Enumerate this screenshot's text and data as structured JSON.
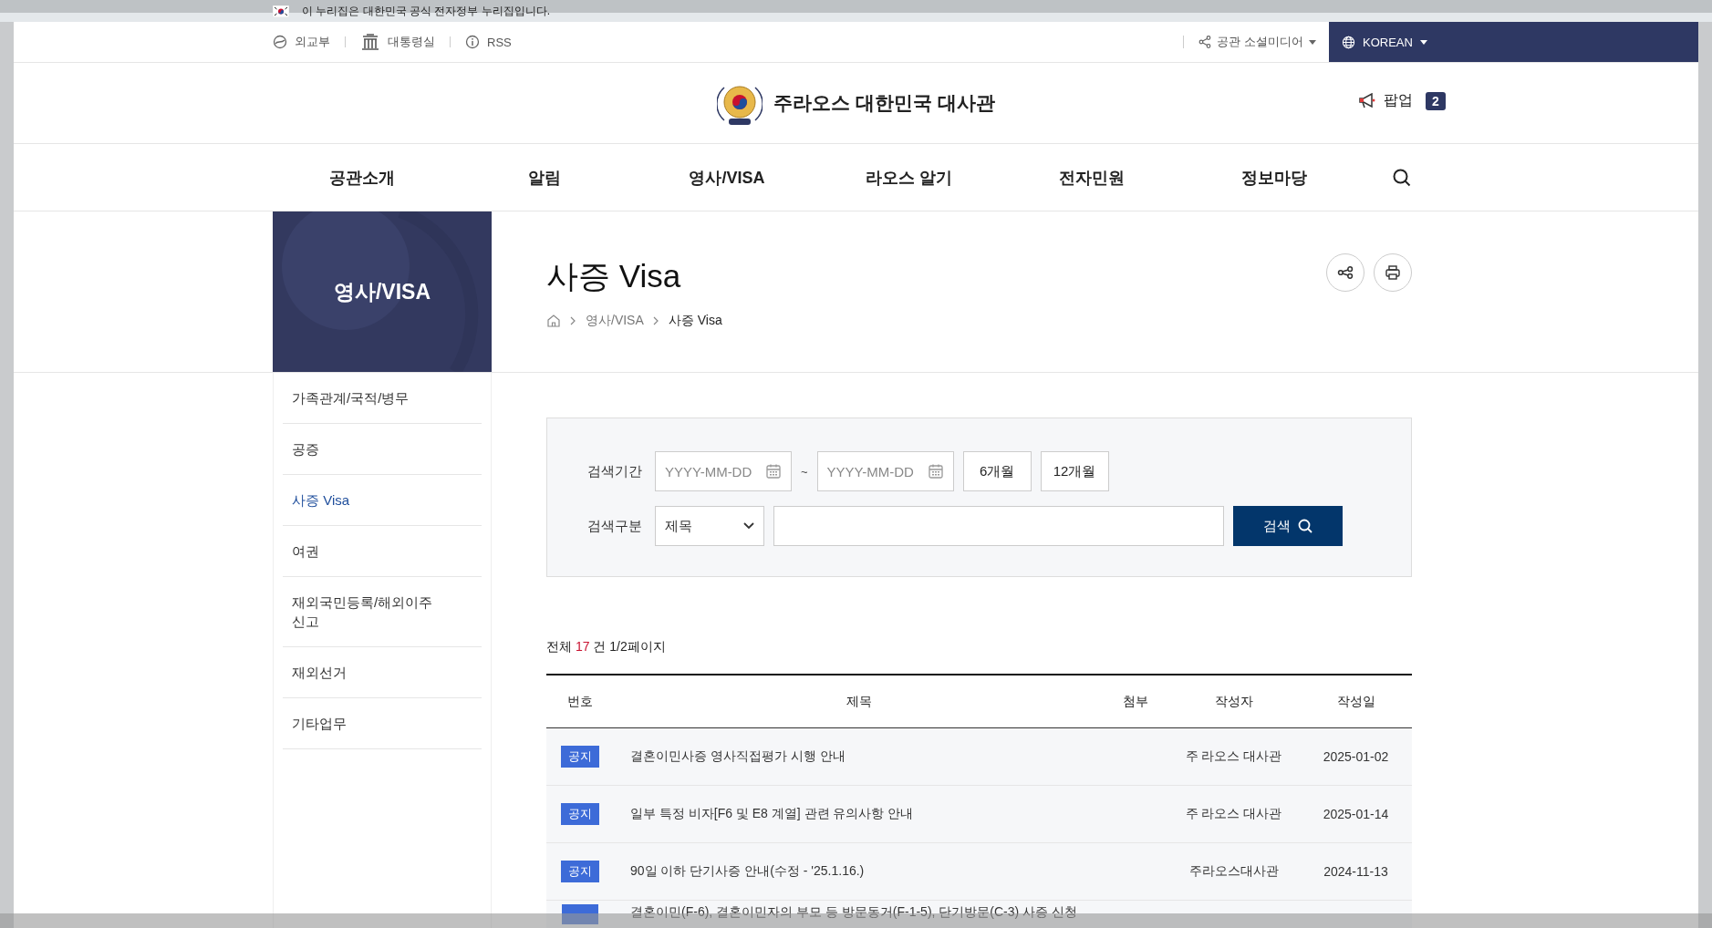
{
  "gov_banner": {
    "text": "이 누리집은 대한민국 공식 전자정부 누리집입니다."
  },
  "utility_bar": {
    "links": [
      {
        "label": "외교부",
        "kind": "circle"
      },
      {
        "label": "대통령실",
        "kind": "building"
      },
      {
        "label": "RSS",
        "kind": "info"
      }
    ],
    "social": {
      "label": "공관 소셜미디어"
    },
    "language": {
      "label": "KOREAN"
    }
  },
  "header": {
    "title": "주라오스 대한민국 대사관",
    "popup": {
      "label": "팝업",
      "count": "2"
    }
  },
  "nav": {
    "items": [
      {
        "label": "공관소개"
      },
      {
        "label": "알림"
      },
      {
        "label": "영사/VISA"
      },
      {
        "label": "라오스 알기"
      },
      {
        "label": "전자민원"
      },
      {
        "label": "정보마당"
      }
    ]
  },
  "section_banner": {
    "title": "영사/VISA"
  },
  "sidebar": {
    "items": [
      {
        "label": "가족관계/국적/병무",
        "selected": false
      },
      {
        "label": "공증",
        "selected": false
      },
      {
        "label": "사증 Visa",
        "selected": true
      },
      {
        "label": "여권",
        "selected": false
      },
      {
        "label": "재외국민등록/해외이주신고",
        "selected": false
      },
      {
        "label": "재외선거",
        "selected": false
      },
      {
        "label": "기타업무",
        "selected": false
      }
    ]
  },
  "page": {
    "title": "사증 Visa",
    "breadcrumb": [
      "영사/VISA",
      "사증 Visa"
    ]
  },
  "search": {
    "period_label": "검색기간",
    "start_placeholder": "YYYY-MM-DD",
    "separator": "~",
    "end_placeholder": "YYYY-MM-DD",
    "quick_buttons": [
      "6개월",
      "12개월"
    ],
    "type_label": "검색구분",
    "type_value": "제목",
    "button": "검색"
  },
  "summary": {
    "prefix": "전체",
    "count": "17",
    "unit": "건",
    "pages": "1/2페이지"
  },
  "table": {
    "columns": [
      "번호",
      "제목",
      "첨부",
      "작성자",
      "작성일"
    ],
    "rows": [
      {
        "badge": "공지",
        "title": "결혼이민사증 영사직접평가 시행 안내",
        "author": "주 라오스 대사관",
        "date": "2025-01-02"
      },
      {
        "badge": "공지",
        "title": "일부 특정 비자[F6 및 E8 계열] 관련 유의사항 안내",
        "author": "주 라오스 대사관",
        "date": "2025-01-14"
      },
      {
        "badge": "공지",
        "title": "90일 이하 단기사증 안내(수정 - '25.1.16.)",
        "author": "주라오스대사관",
        "date": "2024-11-13"
      },
      {
        "title": "결혼이민(F-6), 결혼이민자의 부모 등 방문동거(F-1-5), 단기방문(C-3) 사증 신청"
      }
    ]
  }
}
